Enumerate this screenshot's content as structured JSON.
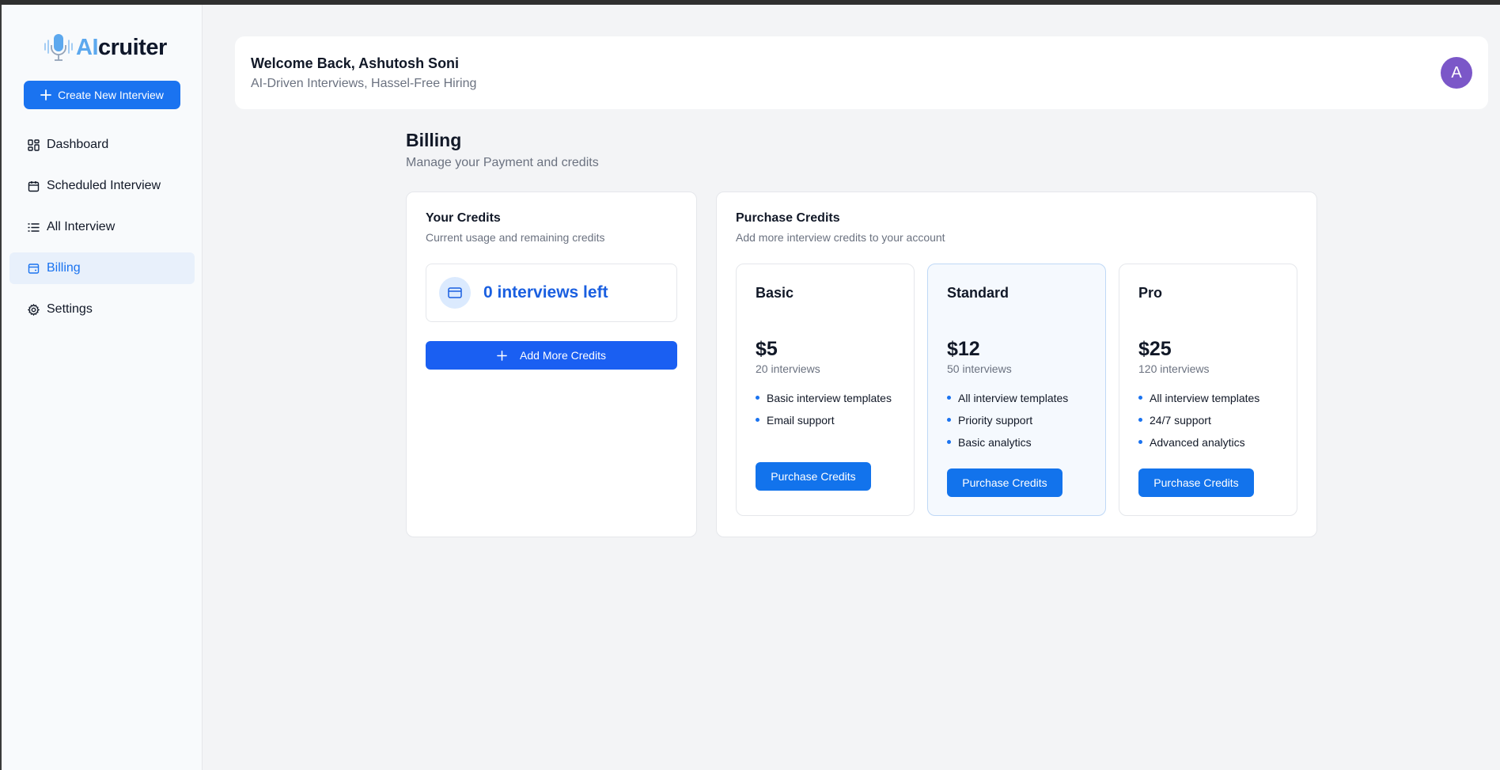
{
  "app": {
    "logo_ai": "AI",
    "logo_rest": "cruiter"
  },
  "sidebar": {
    "create_label": "Create New Interview",
    "items": [
      {
        "label": "Dashboard",
        "icon": "layout-dashboard-icon"
      },
      {
        "label": "Scheduled Interview",
        "icon": "calendar-icon"
      },
      {
        "label": "All Interview",
        "icon": "list-icon"
      },
      {
        "label": "Billing",
        "icon": "wallet-icon",
        "active": true
      },
      {
        "label": "Settings",
        "icon": "gear-icon"
      }
    ]
  },
  "header": {
    "welcome": "Welcome Back, Ashutosh Soni",
    "tagline": "AI-Driven Interviews, Hassel-Free Hiring",
    "avatar_initial": "A"
  },
  "billing": {
    "title": "Billing",
    "subtitle": "Manage your Payment and credits"
  },
  "credits": {
    "title": "Your Credits",
    "subtitle": "Current usage and remaining credits",
    "count_label": "0 interviews left",
    "add_label": "Add More Credits"
  },
  "purchase": {
    "title": "Purchase Credits",
    "subtitle": "Add more interview credits to your account",
    "plans": [
      {
        "name": "Basic",
        "price": "$5",
        "interviews": "20 interviews",
        "features": [
          "Basic interview templates",
          "Email support"
        ],
        "button": "Purchase Credits"
      },
      {
        "name": "Standard",
        "price": "$12",
        "interviews": "50 interviews",
        "features": [
          "All interview templates",
          "Priority support",
          "Basic analytics"
        ],
        "button": "Purchase Credits"
      },
      {
        "name": "Pro",
        "price": "$25",
        "interviews": "120 interviews",
        "features": [
          "All interview templates",
          "24/7 support",
          "Advanced analytics"
        ],
        "button": "Purchase Credits"
      }
    ]
  },
  "colors": {
    "accent": "#1a73f0",
    "avatar": "#7b57c8",
    "logo_ai": "#5ca8ee"
  }
}
